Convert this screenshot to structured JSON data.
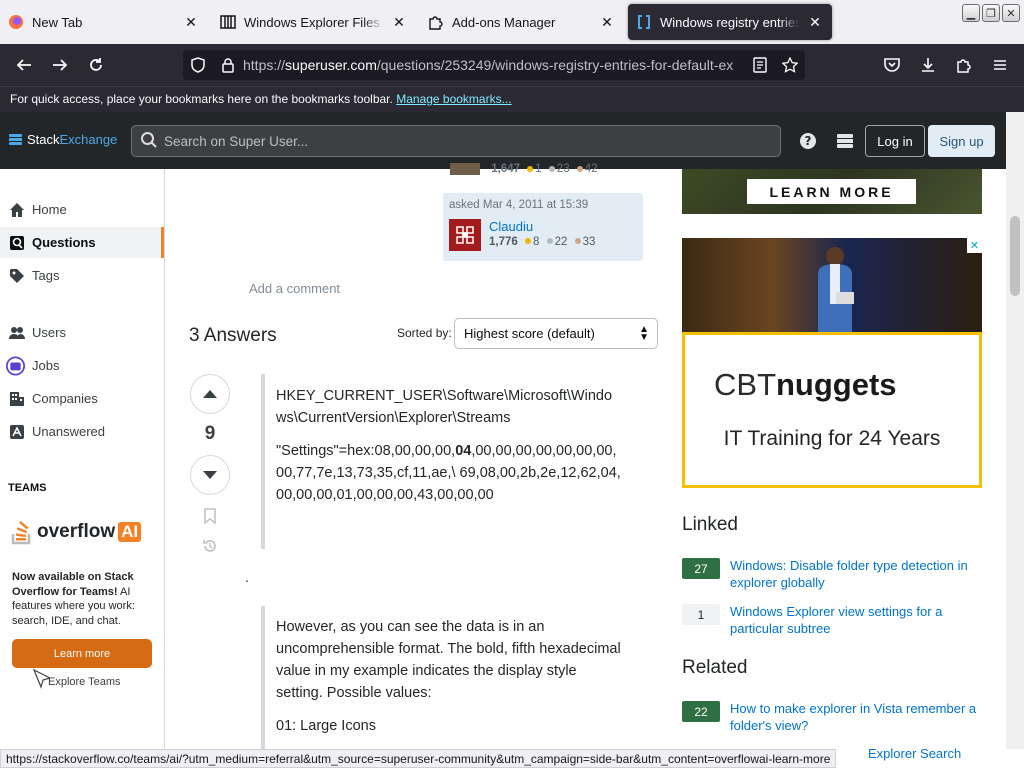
{
  "browser": {
    "tabs": [
      {
        "title": "New Tab",
        "icon": "firefox-icon"
      },
      {
        "title": "Windows Explorer Files : Mic",
        "icon": "archive-icon"
      },
      {
        "title": "Add-ons Manager",
        "icon": "puzzle-icon"
      },
      {
        "title": "Windows registry entries for",
        "icon": "superuser-icon",
        "active": true
      }
    ],
    "url_prefix": "https://",
    "url_host": "superuser.com",
    "url_path": "/questions/253249/windows-registry-entries-for-default-ex",
    "bookmarks_text": "For quick access, place your bookmarks here on the bookmarks toolbar.",
    "bookmarks_link": "Manage bookmarks..."
  },
  "se_header": {
    "logo_stack": "Stack",
    "logo_exchange": "Exchange",
    "search_placeholder": "Search on Super User...",
    "login": "Log in",
    "signup": "Sign up"
  },
  "leftnav": {
    "items": [
      {
        "label": "Home",
        "icon": "home-icon"
      },
      {
        "label": "Questions",
        "icon": "questions-icon",
        "active": true
      },
      {
        "label": "Tags",
        "icon": "tag-icon"
      },
      {
        "label": "Users",
        "icon": "users-icon"
      },
      {
        "label": "Jobs",
        "icon": "briefcase-icon"
      },
      {
        "label": "Companies",
        "icon": "building-icon"
      },
      {
        "label": "Unanswered",
        "icon": "unanswered-icon"
      }
    ],
    "teams_heading": "TEAMS",
    "overflow_word": "overflow",
    "ai_word": "AI",
    "teams_bold": "Now available on Stack Overflow for Teams!",
    "teams_text": " AI features where you work: search, IDE, and chat.",
    "learn_more": "Learn more",
    "explore_teams": "Explore Teams"
  },
  "question": {
    "prev_user_rep": "1,647",
    "prev_gold": "1",
    "prev_silver": "23",
    "prev_bronze": "42",
    "asked": "asked Mar 4, 2011 at 15:39",
    "asker_name": "Claudiu",
    "asker_rep": "1,776",
    "asker_gold": "8",
    "asker_silver": "22",
    "asker_bronze": "33",
    "add_comment": "Add a comment"
  },
  "answers": {
    "heading": "3 Answers",
    "sorted_by_label": "Sorted by:",
    "sort_value": "Highest score (default)",
    "first_answer": {
      "score": "9",
      "p1": "HKEY_CURRENT_USER\\Software\\Microsoft\\Windows\\CurrentVersion\\Explorer\\Streams",
      "p2_before": "\"Settings\"=hex:08,00,00,00,",
      "p2_bold": "04",
      "p2_after": ",00,00,00,00,00,00,00,00,77,7e,13,73,35,cf,11,ae,\\ 69,08,00,2b,2e,12,62,04,00,00,00,01,00,00,00,43,00,00,00"
    },
    "stray": ".",
    "second_block": {
      "p1": "However, as you can see the data is in an uncomprehensible format. The bold, fifth hexadecimal value in my example indicates the display style setting. Possible values:",
      "p2": "01: Large Icons"
    }
  },
  "ads": {
    "learn_more": "LEARN MORE",
    "cbt_a": "CBT",
    "cbt_b": "nuggets",
    "tagline": "IT Training for 24 Years"
  },
  "linked": {
    "heading": "Linked",
    "items": [
      {
        "count": "27",
        "title": "Windows: Disable folder type detection in explorer globally",
        "accepted": true
      },
      {
        "count": "1",
        "title": "Windows Explorer view settings for a particular subtree",
        "accepted": false
      }
    ]
  },
  "related": {
    "heading": "Related",
    "items": [
      {
        "count": "22",
        "title": "How to make explorer in Vista remember a folder's view?",
        "accepted": true
      },
      {
        "count": "",
        "title": "Explorer Search",
        "accepted": false
      }
    ]
  },
  "status_url": "https://stackoverflow.co/teams/ai/?utm_medium=referral&utm_source=superuser-community&utm_campaign=side-bar&utm_content=overflowai-learn-more",
  "colors": {
    "accent_orange": "#f48225",
    "link_blue": "#0074cc",
    "accepted_green": "#2f6f44",
    "header_dark": "#232629",
    "browser_dark": "#2b2a33"
  }
}
